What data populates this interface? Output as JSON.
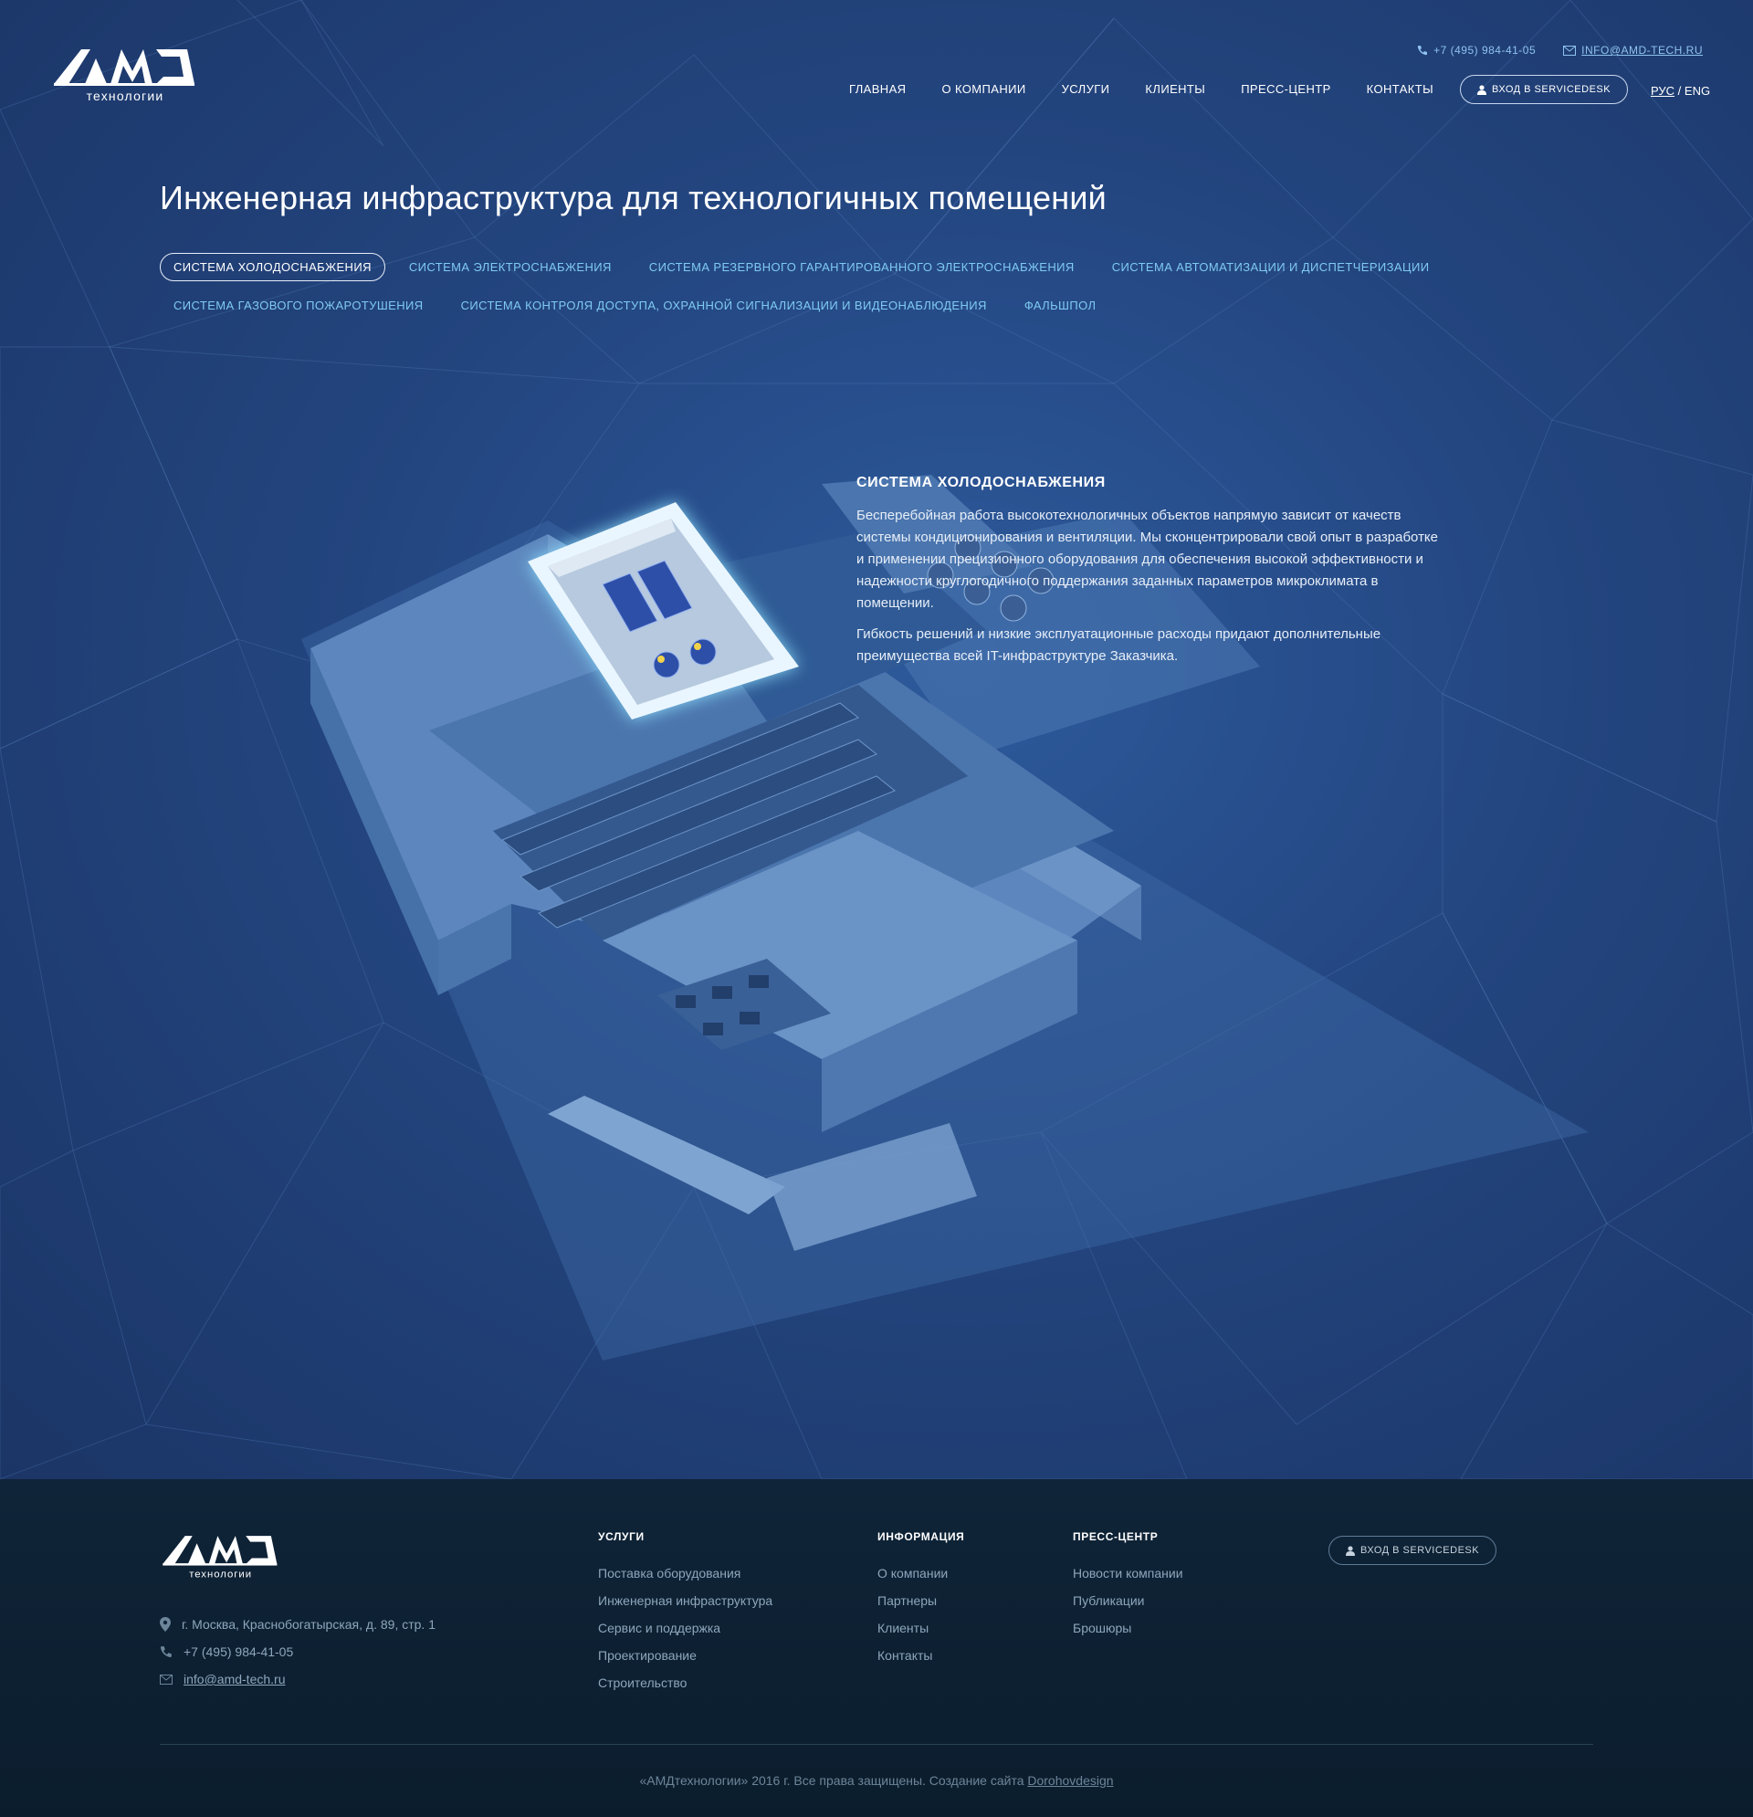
{
  "header": {
    "logo_word": "AMD",
    "logo_sub": "технологии",
    "phone": "+7 (495) 984-41-05",
    "email": "INFO@AMD-TECH.RU",
    "nav": [
      "ГЛАВНАЯ",
      "О КОМПАНИИ",
      "УСЛУГИ",
      "КЛИЕНТЫ",
      "ПРЕСС-ЦЕНТР",
      "КОНТАКТЫ"
    ],
    "servicedesk": "ВХОД В SERVICEDESK",
    "lang_active": "РУС",
    "lang_sep": "/",
    "lang_other": "ENG"
  },
  "page": {
    "title": "Инженерная инфраструктура для технологичных помещений",
    "tabs_row1": [
      "СИСТЕМА ХОЛОДОСНАБЖЕНИЯ",
      "СИСТЕМА ЭЛЕКТРОСНАБЖЕНИЯ",
      "СИСТЕМА РЕЗЕРВНОГО ГАРАНТИРОВАННОГО ЭЛЕКТРОСНАБЖЕНИЯ",
      "СИСТЕМА АВТОМАТИЗАЦИИ И ДИСПЕТЧЕРИЗАЦИИ"
    ],
    "tabs_row2": [
      "СИСТЕМА ГАЗОВОГО ПОЖАРОТУШЕНИЯ",
      "СИСТЕМА КОНТРОЛЯ ДОСТУПА, ОХРАННОЙ СИГНАЛИЗАЦИИ И ВИДЕОНАБЛЮДЕНИЯ",
      "ФАЛЬШПОЛ"
    ],
    "active_tab": "СИСТЕМА ХОЛОДОСНАБЖЕНИЯ"
  },
  "detail": {
    "title": "СИСТЕМА ХОЛОДОСНАБЖЕНИЯ",
    "p1": "Бесперебойная работа высокотехнологичных объектов напрямую зависит от качеств системы кондиционирования и вентиляции. Мы сконцентрировали свой опыт в разработке и применении прецизионного оборудования для обеспечения высокой эффективности и надежности круглогодичного поддержания заданных параметров микроклимата в помещении.",
    "p2": "Гибкость решений и низкие эксплуатационные расходы придают дополнительные преимущества всей IT-инфраструктуре Заказчика."
  },
  "footer": {
    "address": "г. Москва, Красноб­огатырская, д. 89, стр. 1",
    "phone": "+7 (495) 984-41-05",
    "email": "info@amd-tech.ru",
    "services_title": "УСЛУГИ",
    "services": [
      "Поставка оборудования",
      "Инженерная инфраструктура",
      "Сервис и поддержка",
      "Проектирование",
      "Строительство"
    ],
    "info_title": "ИНФОРМАЦИЯ",
    "info": [
      "О компании",
      "Партнеры",
      "Клиенты",
      "Контакты"
    ],
    "press_title": "ПРЕСС-ЦЕНТР",
    "press": [
      "Новости компании",
      "Публикации",
      "Брошюры"
    ],
    "servicedesk": "ВХОД В SERVICEDESK",
    "copyright": "«АМДтехнологии» 2016 г. Все права защищены. Создание сайта",
    "credit": "Dorohovdesign"
  },
  "colors": {
    "bg": "#23457f",
    "accent": "#7fcaf2",
    "footer_bg": "#0f2438",
    "glow": "#8fe3ff"
  },
  "icons": [
    "phone-icon",
    "mail-icon",
    "user-icon",
    "pin-icon"
  ]
}
